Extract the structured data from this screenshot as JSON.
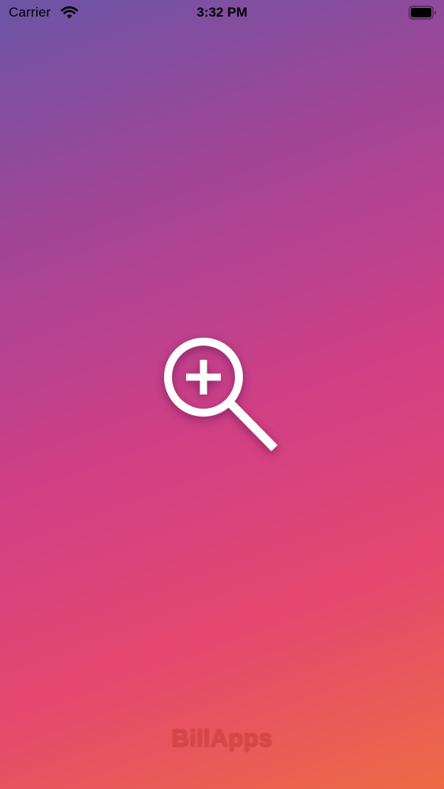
{
  "status_bar": {
    "carrier": "Carrier",
    "time": "3:32 PM",
    "icons": [
      "wifi-icon",
      "battery-icon"
    ]
  },
  "splash": {
    "logo_icon": "zoom-in-magnifier-icon",
    "brand_text": "BillApps",
    "colors": {
      "gradient_start": "#6b55a6",
      "gradient_mid": "#d03f86",
      "gradient_end": "#ee6a45",
      "logo": "#ffffff",
      "brand": "#d94646"
    }
  }
}
